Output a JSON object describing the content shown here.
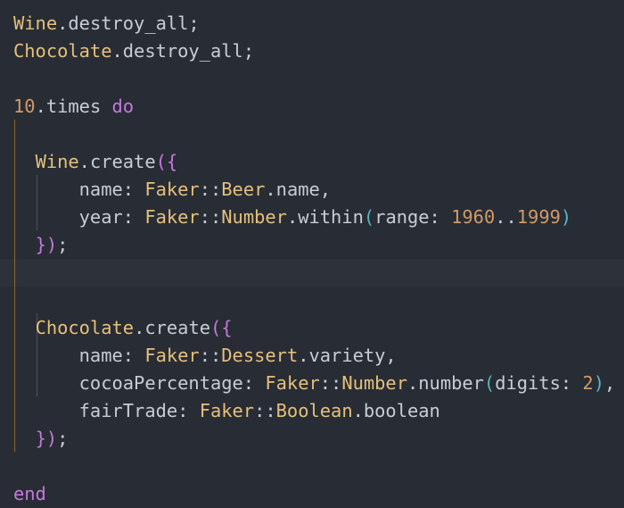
{
  "editor": {
    "lines": [
      {
        "tokens": [
          {
            "t": "Wine",
            "c": "cls",
            "name": "class-name"
          },
          {
            "t": ".destroy_all;",
            "c": "fn",
            "name": "method-call"
          }
        ]
      },
      {
        "tokens": [
          {
            "t": "Chocolate",
            "c": "cls",
            "name": "class-name"
          },
          {
            "t": ".destroy_all;",
            "c": "fn",
            "name": "method-call"
          }
        ]
      },
      {
        "tokens": []
      },
      {
        "tokens": [
          {
            "t": "10",
            "c": "num",
            "name": "number-literal"
          },
          {
            "t": ".times ",
            "c": "fn",
            "name": "method-call"
          },
          {
            "t": "do",
            "c": "kw",
            "name": "keyword"
          }
        ]
      },
      {
        "tokens": []
      },
      {
        "tokens": [
          {
            "t": "  ",
            "c": "fn",
            "name": "indent"
          },
          {
            "t": "Wine",
            "c": "cls",
            "name": "class-name"
          },
          {
            "t": ".create",
            "c": "fn",
            "name": "method-call"
          },
          {
            "t": "(",
            "c": "br1",
            "name": "bracket"
          },
          {
            "t": "{",
            "c": "br1",
            "name": "bracket"
          }
        ]
      },
      {
        "tokens": [
          {
            "t": "      name: ",
            "c": "fn",
            "name": "hash-key"
          },
          {
            "t": "Faker",
            "c": "cls",
            "name": "class-name"
          },
          {
            "t": "::",
            "c": "op",
            "name": "operator"
          },
          {
            "t": "Beer",
            "c": "cls",
            "name": "class-name"
          },
          {
            "t": ".name,",
            "c": "fn",
            "name": "method-call"
          }
        ]
      },
      {
        "tokens": [
          {
            "t": "      year: ",
            "c": "fn",
            "name": "hash-key"
          },
          {
            "t": "Faker",
            "c": "cls",
            "name": "class-name"
          },
          {
            "t": "::",
            "c": "op",
            "name": "operator"
          },
          {
            "t": "Number",
            "c": "cls",
            "name": "class-name"
          },
          {
            "t": ".within",
            "c": "fn",
            "name": "method-call"
          },
          {
            "t": "(",
            "c": "br2",
            "name": "bracket"
          },
          {
            "t": "range: ",
            "c": "fn",
            "name": "argument-key"
          },
          {
            "t": "1960",
            "c": "num",
            "name": "number-literal"
          },
          {
            "t": "..",
            "c": "op",
            "name": "operator"
          },
          {
            "t": "1999",
            "c": "num",
            "name": "number-literal"
          },
          {
            "t": ")",
            "c": "br2",
            "name": "bracket"
          }
        ]
      },
      {
        "tokens": [
          {
            "t": "  ",
            "c": "fn",
            "name": "indent"
          },
          {
            "t": "}",
            "c": "br1",
            "name": "bracket"
          },
          {
            "t": ")",
            "c": "br1",
            "name": "bracket"
          },
          {
            "t": ";",
            "c": "fn",
            "name": "punctuation"
          }
        ]
      },
      {
        "tokens": []
      },
      {
        "tokens": []
      },
      {
        "tokens": [
          {
            "t": "  ",
            "c": "fn",
            "name": "indent"
          },
          {
            "t": "Chocolate",
            "c": "cls",
            "name": "class-name"
          },
          {
            "t": ".create",
            "c": "fn",
            "name": "method-call"
          },
          {
            "t": "(",
            "c": "br1",
            "name": "bracket"
          },
          {
            "t": "{",
            "c": "br1",
            "name": "bracket"
          }
        ]
      },
      {
        "tokens": [
          {
            "t": "      name: ",
            "c": "fn",
            "name": "hash-key"
          },
          {
            "t": "Faker",
            "c": "cls",
            "name": "class-name"
          },
          {
            "t": "::",
            "c": "op",
            "name": "operator"
          },
          {
            "t": "Dessert",
            "c": "cls",
            "name": "class-name"
          },
          {
            "t": ".variety,",
            "c": "fn",
            "name": "method-call"
          }
        ]
      },
      {
        "tokens": [
          {
            "t": "      cocoaPercentage: ",
            "c": "fn",
            "name": "hash-key"
          },
          {
            "t": "Faker",
            "c": "cls",
            "name": "class-name"
          },
          {
            "t": "::",
            "c": "op",
            "name": "operator"
          },
          {
            "t": "Number",
            "c": "cls",
            "name": "class-name"
          },
          {
            "t": ".number",
            "c": "fn",
            "name": "method-call"
          },
          {
            "t": "(",
            "c": "br2",
            "name": "bracket"
          },
          {
            "t": "digits: ",
            "c": "fn",
            "name": "argument-key"
          },
          {
            "t": "2",
            "c": "num",
            "name": "number-literal"
          },
          {
            "t": ")",
            "c": "br2",
            "name": "bracket"
          },
          {
            "t": ",",
            "c": "fn",
            "name": "punctuation"
          }
        ]
      },
      {
        "tokens": [
          {
            "t": "      fairTrade: ",
            "c": "fn",
            "name": "hash-key"
          },
          {
            "t": "Faker",
            "c": "cls",
            "name": "class-name"
          },
          {
            "t": "::",
            "c": "op",
            "name": "operator"
          },
          {
            "t": "Boolean",
            "c": "cls",
            "name": "class-name"
          },
          {
            "t": ".boolean",
            "c": "fn",
            "name": "method-call"
          }
        ]
      },
      {
        "tokens": [
          {
            "t": "  ",
            "c": "fn",
            "name": "indent"
          },
          {
            "t": "}",
            "c": "br1",
            "name": "bracket"
          },
          {
            "t": ")",
            "c": "br1",
            "name": "bracket"
          },
          {
            "t": ";",
            "c": "fn",
            "name": "punctuation"
          }
        ]
      },
      {
        "tokens": []
      },
      {
        "tokens": [
          {
            "t": "end",
            "c": "kw",
            "name": "keyword"
          }
        ]
      }
    ]
  },
  "theme": {
    "background": "#282c34",
    "current_line": "#2c313a",
    "text": "#c8ccd4",
    "class": "#e5c07b",
    "keyword": "#c678dd",
    "number": "#d19a66",
    "bracket_inner": "#56b6c2"
  }
}
